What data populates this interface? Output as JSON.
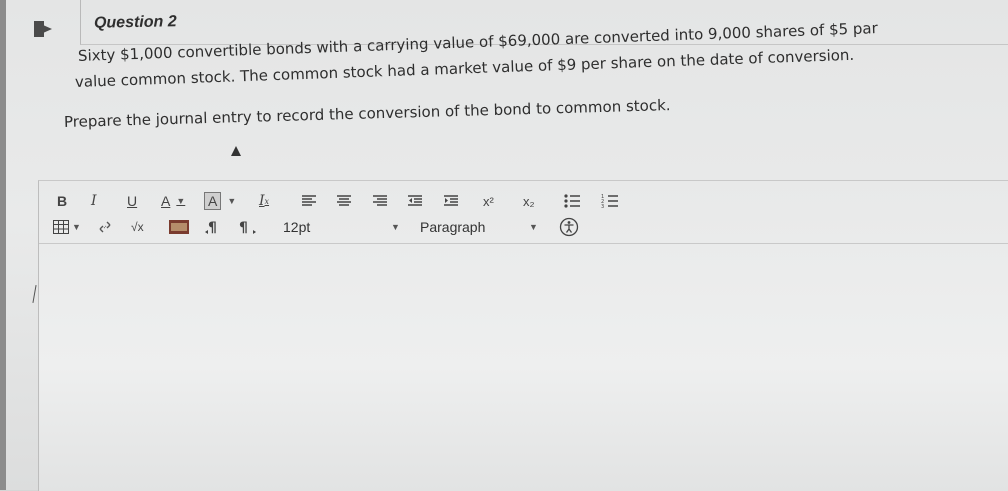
{
  "question": {
    "title": "Question 2",
    "body_line1": "Sixty $1,000 convertible bonds with a carrying value of $69,000 are converted into 9,000 shares of $5 par",
    "body_line2": "value common stock. The common stock had a market value of $9 per share on the date of conversion.",
    "prompt": "Prepare the journal entry to record the conversion of the bond to common stock."
  },
  "toolbar": {
    "bold": "B",
    "italic": "I",
    "underline": "U",
    "font_color": "A",
    "highlight": "A",
    "superscript": "x²",
    "subscript": "x₂",
    "font_size": "12pt",
    "paragraph": "Paragraph"
  },
  "editor": {
    "content": ""
  }
}
